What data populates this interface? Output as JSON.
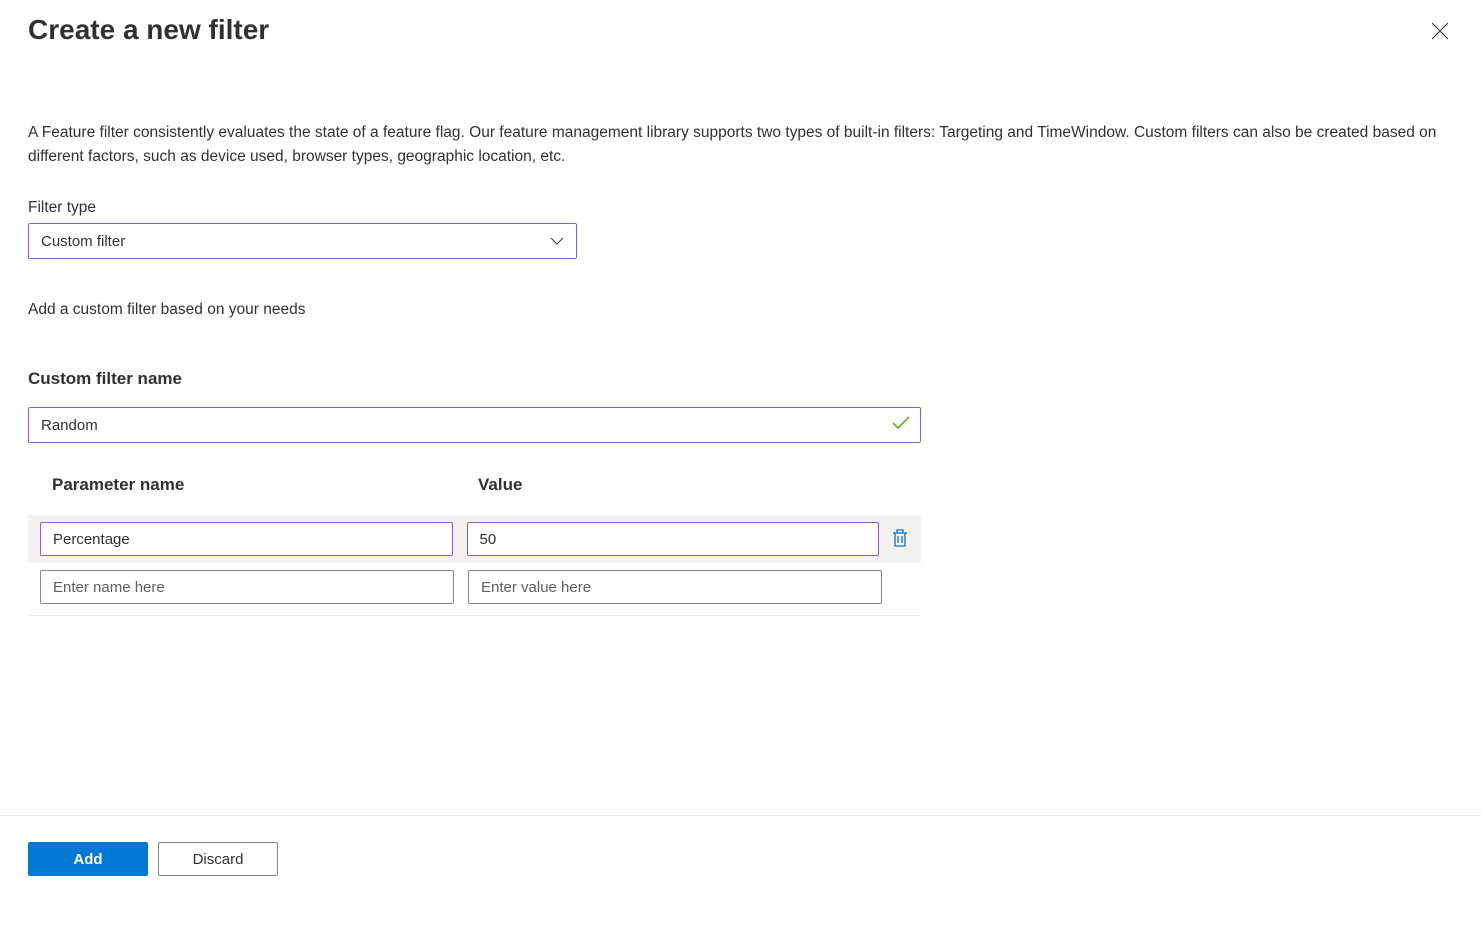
{
  "header": {
    "title": "Create a new filter"
  },
  "description": "A Feature filter consistently evaluates the state of a feature flag. Our feature management library supports two types of built-in filters: Targeting and TimeWindow. Custom filters can also be created based on different factors, such as device used, browser types, geographic location, etc.",
  "filterType": {
    "label": "Filter type",
    "selected": "Custom filter"
  },
  "subtext": "Add a custom filter based on your needs",
  "customName": {
    "label": "Custom filter name",
    "value": "Random"
  },
  "paramTable": {
    "headers": {
      "name": "Parameter name",
      "value": "Value"
    },
    "rows": [
      {
        "name": "Percentage",
        "value": "50"
      }
    ],
    "placeholders": {
      "name": "Enter name here",
      "value": "Enter value here"
    }
  },
  "footer": {
    "add": "Add",
    "discard": "Discard"
  }
}
